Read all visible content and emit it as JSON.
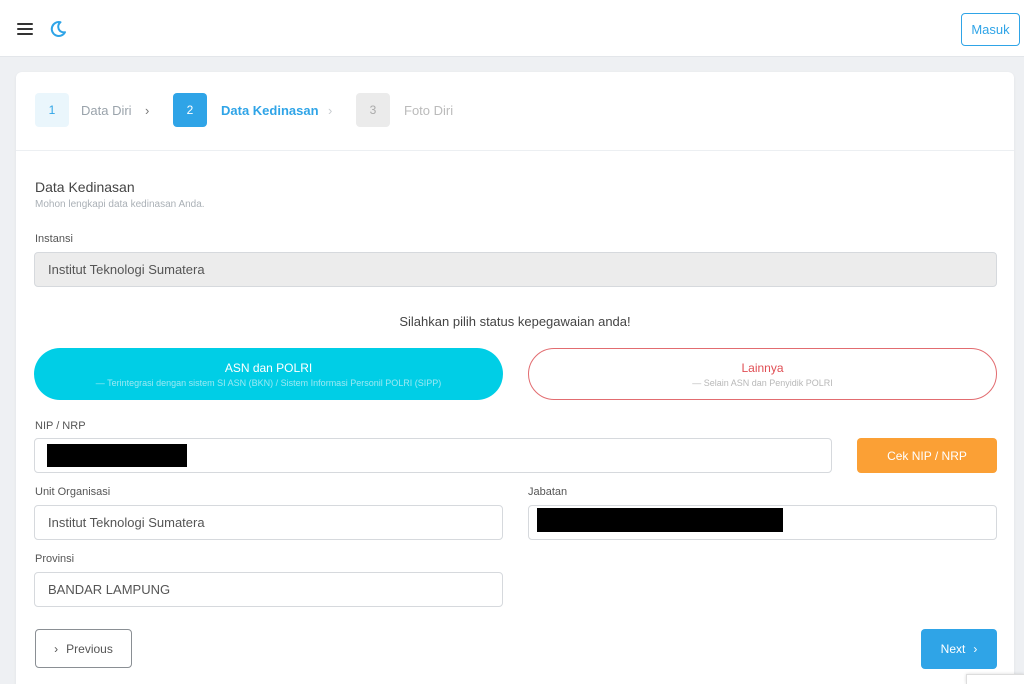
{
  "header": {
    "login_label": "Masuk"
  },
  "stepper": {
    "steps": [
      {
        "number": "1",
        "label": "Data Diri",
        "chevron": "›"
      },
      {
        "number": "2",
        "label": "Data Kedinasan",
        "chevron": "›"
      },
      {
        "number": "3",
        "label": "Foto Diri"
      }
    ],
    "active_index": 1
  },
  "section": {
    "title": "Data Kedinasan",
    "subtitle": "Mohon lengkapi data kedinasan Anda."
  },
  "form": {
    "instansi": {
      "label": "Instansi",
      "value": "Institut Teknologi Sumatera"
    },
    "status_prompt": "Silahkan pilih status kepegawaian anda!",
    "status_options": {
      "asn": {
        "title": "ASN dan POLRI",
        "subtitle": "— Terintegrasi dengan sistem SI ASN (BKN) / Sistem Informasi Personil POLRI (SIPP)"
      },
      "lainnya": {
        "title": "Lainnya",
        "subtitle": "— Selain ASN dan Penyidik POLRI"
      }
    },
    "nip": {
      "label": "NIP / NRP",
      "value": ""
    },
    "cek_button": "Cek NIP / NRP",
    "unit_organisasi": {
      "label": "Unit Organisasi",
      "value": "Institut Teknologi Sumatera"
    },
    "jabatan": {
      "label": "Jabatan",
      "value": ""
    },
    "provinsi": {
      "label": "Provinsi",
      "value": "BANDAR LAMPUNG"
    }
  },
  "nav": {
    "previous": {
      "chevron": "›",
      "label": "Previous"
    },
    "next": {
      "label": "Next",
      "chevron": "›"
    }
  },
  "colors": {
    "primary": "#2fa4e7",
    "cyan": "#00cee6",
    "orange": "#fba035",
    "danger": "#e04e54"
  },
  "icons": {
    "menu": "hamburger-icon",
    "theme": "moon-icon"
  }
}
